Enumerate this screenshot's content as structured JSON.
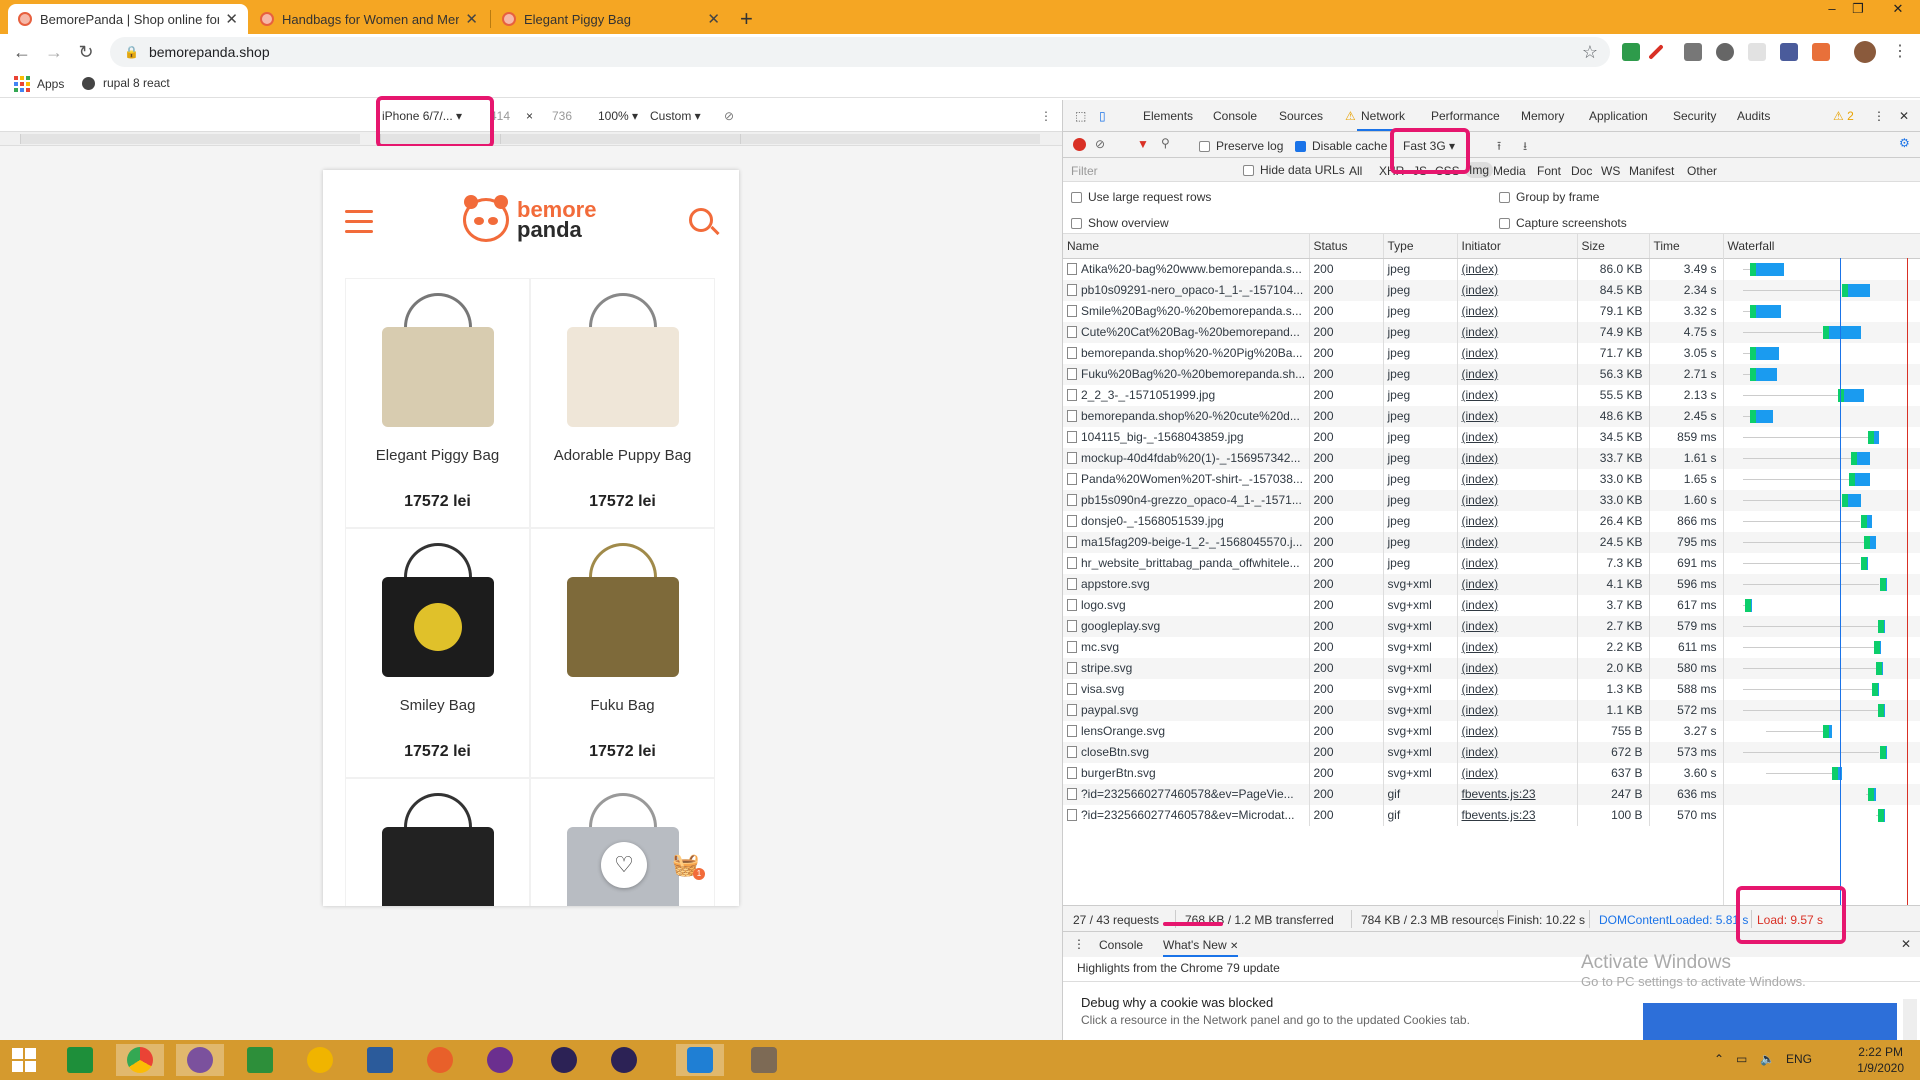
{
  "browser": {
    "tabs": [
      {
        "title": "BemorePanda | Shop online for S",
        "active": true
      },
      {
        "title": "Handbags for Women and Men |",
        "active": false
      },
      {
        "title": "Elegant Piggy Bag",
        "active": false
      }
    ],
    "new_tab": "+",
    "window_controls": {
      "minimize": "–",
      "maximize": "❐",
      "close": "✕"
    },
    "url": "bemorepanda.shop",
    "bookmarks": [
      {
        "label": "Apps",
        "icon": "apps-grid-icon"
      },
      {
        "label": "rupal 8 react",
        "icon": "globe-icon"
      }
    ]
  },
  "device_toolbar": {
    "device": "iPhone 6/7/...",
    "width": "414",
    "times": "×",
    "height": "736",
    "zoom": "100%",
    "throttle": "Custom"
  },
  "site": {
    "logo_top": "bemore",
    "logo_bottom": "panda",
    "accent": "#f26b3a",
    "products": [
      {
        "name": "Elegant Piggy Bag",
        "price": "17572 lei",
        "bag_color": "#d8ccb0",
        "handle_color": "#777"
      },
      {
        "name": "Adorable Puppy Bag",
        "price": "17572 lei",
        "bag_color": "#efe6d8",
        "handle_color": "#888"
      },
      {
        "name": "Smiley Bag",
        "price": "17572 lei",
        "bag_color": "#1c1c1c",
        "handle_color": "#333"
      },
      {
        "name": "Fuku Bag",
        "price": "17572 lei",
        "bag_color": "#7e6a3a",
        "handle_color": "#a08a4a"
      },
      {
        "name": "",
        "price": "",
        "bag_color": "#222",
        "handle_color": "#333"
      },
      {
        "name": "",
        "price": "",
        "bag_color": "#b8bcc2",
        "handle_color": "#999"
      }
    ],
    "cart_badge": "1"
  },
  "devtools": {
    "tabs": [
      "Elements",
      "Console",
      "Sources",
      "Network",
      "Performance",
      "Memory",
      "Application",
      "Security",
      "Audits"
    ],
    "active_tab": "Network",
    "warning_count": "2",
    "preserve_log": "Preserve log",
    "disable_cache": "Disable cache",
    "throttling": "Fast 3G",
    "filter_placeholder": "Filter",
    "hide_data_urls": "Hide data URLs",
    "type_filters": [
      "All",
      "XHR",
      "JS",
      "CSS",
      "Img",
      "Media",
      "Font",
      "Doc",
      "WS",
      "Manifest",
      "Other"
    ],
    "options": {
      "large_rows": "Use large request rows",
      "group_by_frame": "Group by frame",
      "show_overview": "Show overview",
      "capture_screenshots": "Capture screenshots"
    },
    "columns": [
      "Name",
      "Status",
      "Type",
      "Initiator",
      "Size",
      "Time",
      "Waterfall"
    ],
    "requests": [
      {
        "name": "Atika%20-bag%20www.bemorepanda.s...",
        "status": "200",
        "type": "jpeg",
        "initiator": "(index)",
        "size": "86.0 KB",
        "time": "3.49 s",
        "wf": [
          0.08,
          0.12,
          0.3
        ]
      },
      {
        "name": "pb10s09291-nero_opaco-1_1-_-157104...",
        "status": "200",
        "type": "jpeg",
        "initiator": "(index)",
        "size": "84.5 KB",
        "time": "2.34 s",
        "wf": [
          0.08,
          0.6,
          0.75
        ]
      },
      {
        "name": "Smile%20Bag%20-%20bemorepanda.s...",
        "status": "200",
        "type": "jpeg",
        "initiator": "(index)",
        "size": "79.1 KB",
        "time": "3.32 s",
        "wf": [
          0.08,
          0.12,
          0.28
        ]
      },
      {
        "name": "Cute%20Cat%20Bag-%20bemorepand...",
        "status": "200",
        "type": "jpeg",
        "initiator": "(index)",
        "size": "74.9 KB",
        "time": "4.75 s",
        "wf": [
          0.08,
          0.5,
          0.7
        ]
      },
      {
        "name": "bemorepanda.shop%20-%20Pig%20Ba...",
        "status": "200",
        "type": "jpeg",
        "initiator": "(index)",
        "size": "71.7 KB",
        "time": "3.05 s",
        "wf": [
          0.08,
          0.12,
          0.27
        ]
      },
      {
        "name": "Fuku%20Bag%20-%20bemorepanda.sh...",
        "status": "200",
        "type": "jpeg",
        "initiator": "(index)",
        "size": "56.3 KB",
        "time": "2.71 s",
        "wf": [
          0.08,
          0.12,
          0.26
        ]
      },
      {
        "name": "2_2_3-_-1571051999.jpg",
        "status": "200",
        "type": "jpeg",
        "initiator": "(index)",
        "size": "55.5 KB",
        "time": "2.13 s",
        "wf": [
          0.08,
          0.58,
          0.72
        ]
      },
      {
        "name": "bemorepanda.shop%20-%20cute%20d...",
        "status": "200",
        "type": "jpeg",
        "initiator": "(index)",
        "size": "48.6 KB",
        "time": "2.45 s",
        "wf": [
          0.08,
          0.12,
          0.24
        ]
      },
      {
        "name": "104115_big-_-1568043859.jpg",
        "status": "200",
        "type": "jpeg",
        "initiator": "(index)",
        "size": "34.5 KB",
        "time": "859 ms",
        "wf": [
          0.08,
          0.74,
          0.8
        ]
      },
      {
        "name": "mockup-40d4fdab%20(1)-_-156957342...",
        "status": "200",
        "type": "jpeg",
        "initiator": "(index)",
        "size": "33.7 KB",
        "time": "1.61 s",
        "wf": [
          0.08,
          0.65,
          0.75
        ]
      },
      {
        "name": "Panda%20Women%20T-shirt-_-157038...",
        "status": "200",
        "type": "jpeg",
        "initiator": "(index)",
        "size": "33.0 KB",
        "time": "1.65 s",
        "wf": [
          0.08,
          0.64,
          0.75
        ]
      },
      {
        "name": "pb15s090n4-grezzo_opaco-4_1-_-1571...",
        "status": "200",
        "type": "jpeg",
        "initiator": "(index)",
        "size": "33.0 KB",
        "time": "1.60 s",
        "wf": [
          0.08,
          0.6,
          0.7
        ]
      },
      {
        "name": "donsje0-_-1568051539.jpg",
        "status": "200",
        "type": "jpeg",
        "initiator": "(index)",
        "size": "26.4 KB",
        "time": "866 ms",
        "wf": [
          0.08,
          0.7,
          0.76
        ]
      },
      {
        "name": "ma15fag209-beige-1_2-_-1568045570.j...",
        "status": "200",
        "type": "jpeg",
        "initiator": "(index)",
        "size": "24.5 KB",
        "time": "795 ms",
        "wf": [
          0.08,
          0.72,
          0.78
        ]
      },
      {
        "name": "hr_website_brittabag_panda_offwhitele...",
        "status": "200",
        "type": "jpeg",
        "initiator": "(index)",
        "size": "7.3 KB",
        "time": "691 ms",
        "wf": [
          0.08,
          0.7,
          0.74
        ]
      },
      {
        "name": "appstore.svg",
        "status": "200",
        "type": "svg+xml",
        "initiator": "(index)",
        "size": "4.1 KB",
        "time": "596 ms",
        "wf": [
          0.08,
          0.8,
          0.84
        ]
      },
      {
        "name": "logo.svg",
        "status": "200",
        "type": "svg+xml",
        "initiator": "(index)",
        "size": "3.7 KB",
        "time": "617 ms",
        "wf": [
          0.08,
          0.09,
          0.13
        ]
      },
      {
        "name": "googleplay.svg",
        "status": "200",
        "type": "svg+xml",
        "initiator": "(index)",
        "size": "2.7 KB",
        "time": "579 ms",
        "wf": [
          0.08,
          0.79,
          0.83
        ]
      },
      {
        "name": "mc.svg",
        "status": "200",
        "type": "svg+xml",
        "initiator": "(index)",
        "size": "2.2 KB",
        "time": "611 ms",
        "wf": [
          0.08,
          0.77,
          0.81
        ]
      },
      {
        "name": "stripe.svg",
        "status": "200",
        "type": "svg+xml",
        "initiator": "(index)",
        "size": "2.0 KB",
        "time": "580 ms",
        "wf": [
          0.08,
          0.78,
          0.82
        ]
      },
      {
        "name": "visa.svg",
        "status": "200",
        "type": "svg+xml",
        "initiator": "(index)",
        "size": "1.3 KB",
        "time": "588 ms",
        "wf": [
          0.08,
          0.76,
          0.8
        ]
      },
      {
        "name": "paypal.svg",
        "status": "200",
        "type": "svg+xml",
        "initiator": "(index)",
        "size": "1.1 KB",
        "time": "572 ms",
        "wf": [
          0.08,
          0.79,
          0.83
        ]
      },
      {
        "name": "lensOrange.svg",
        "status": "200",
        "type": "svg+xml",
        "initiator": "(index)",
        "size": "755 B",
        "time": "3.27 s",
        "wf": [
          0.2,
          0.5,
          0.55
        ]
      },
      {
        "name": "closeBtn.svg",
        "status": "200",
        "type": "svg+xml",
        "initiator": "(index)",
        "size": "672 B",
        "time": "573 ms",
        "wf": [
          0.08,
          0.8,
          0.84
        ]
      },
      {
        "name": "burgerBtn.svg",
        "status": "200",
        "type": "svg+xml",
        "initiator": "(index)",
        "size": "637 B",
        "time": "3.60 s",
        "wf": [
          0.2,
          0.55,
          0.6
        ]
      },
      {
        "name": "?id=2325660277460578&ev=PageVie...",
        "status": "200",
        "type": "gif",
        "initiator": "fbevents.js:23",
        "size": "247 B",
        "time": "636 ms",
        "wf": [
          0.73,
          0.74,
          0.78
        ]
      },
      {
        "name": "?id=2325660277460578&ev=Microdat...",
        "status": "200",
        "type": "gif",
        "initiator": "fbevents.js:23",
        "size": "100 B",
        "time": "570 ms",
        "wf": [
          0.78,
          0.79,
          0.83
        ]
      }
    ],
    "summary": {
      "requests": "27 / 43 requests",
      "transferred": "768 KB / 1.2 MB transferred",
      "resources": "784 KB / 2.3 MB resources",
      "finish": "Finish: 10.22 s",
      "dcl": "DOMContentLoaded: 5.81 s",
      "load": "Load: 9.57 s"
    },
    "drawer": {
      "tabs": [
        "Console",
        "What's New"
      ],
      "active": "What's New",
      "headline": "Highlights from the Chrome 79 update",
      "item_title": "Debug why a cookie was blocked",
      "item_desc": "Click a resource in the Network panel and go to the updated Cookies tab."
    }
  },
  "watermark": {
    "line1": "Activate Windows",
    "line2": "Go to PC settings to activate Windows."
  },
  "taskbar": {
    "lang": "ENG",
    "time": "2:22 PM",
    "date": "1/9/2020"
  }
}
